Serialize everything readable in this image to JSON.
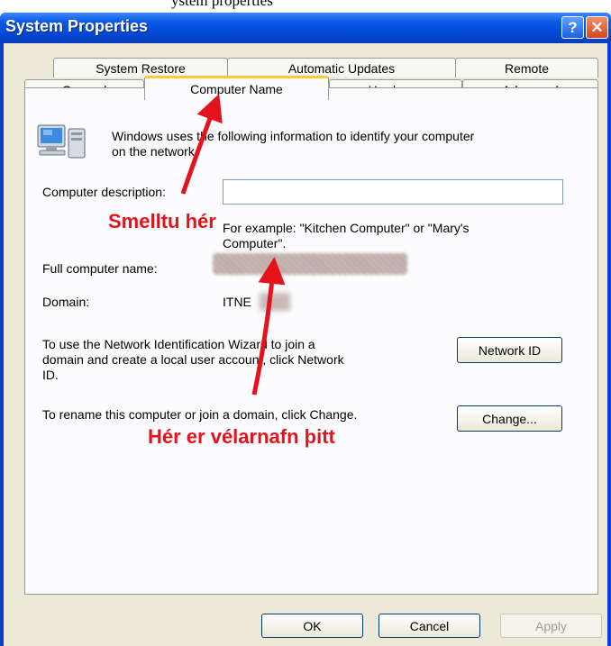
{
  "caption": "ystem properties",
  "window": {
    "title": "System Properties",
    "help_glyph": "?",
    "close_glyph": "✕"
  },
  "tabs": {
    "row1": [
      "System Restore",
      "Automatic Updates",
      "Remote"
    ],
    "row2": [
      "General",
      "Computer Name",
      "Hardware",
      "Advanced"
    ]
  },
  "panel": {
    "intro_line1": "Windows uses the following information to identify your computer",
    "intro_line2": "on the network.",
    "description_label": "Computer description:",
    "description_value": "",
    "example_line1": "For example: \"Kitchen Computer\" or \"Mary's",
    "example_line2": "Computer\".",
    "full_name_label": "Full computer name:",
    "domain_label": "Domain:",
    "domain_value": "ITNE",
    "network_line1": "To use the Network Identification Wizard to join a",
    "network_line2": "domain and create a local user account, click Network",
    "network_line3": "ID.",
    "network_id_button": "Network ID",
    "rename_text": "To rename this computer or join a domain, click Change.",
    "change_button": "Change..."
  },
  "footer": {
    "ok": "OK",
    "cancel": "Cancel",
    "apply": "Apply"
  },
  "annotations": {
    "click_here": "Smelltu hér",
    "computer_name_here": "Hér er vélarnafn þitt",
    "color": "#e4131b"
  }
}
